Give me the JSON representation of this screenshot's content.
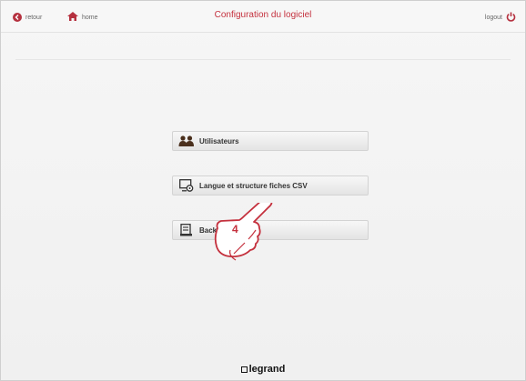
{
  "header": {
    "title": "Configuration du logiciel",
    "back_label": "retour",
    "home_label": "home",
    "logout_label": "logout"
  },
  "menu": {
    "items": [
      {
        "label": "Utilisateurs",
        "icon": "users-icon"
      },
      {
        "label": "Langue et structure fiches CSV",
        "icon": "screen-settings-icon"
      },
      {
        "label": "Backup/restore",
        "icon": "backup-icon"
      }
    ]
  },
  "callout": {
    "number": "4"
  },
  "footer": {
    "brand": "legrand"
  },
  "colors": {
    "accent": "#c4303d",
    "button_text": "#333333"
  }
}
